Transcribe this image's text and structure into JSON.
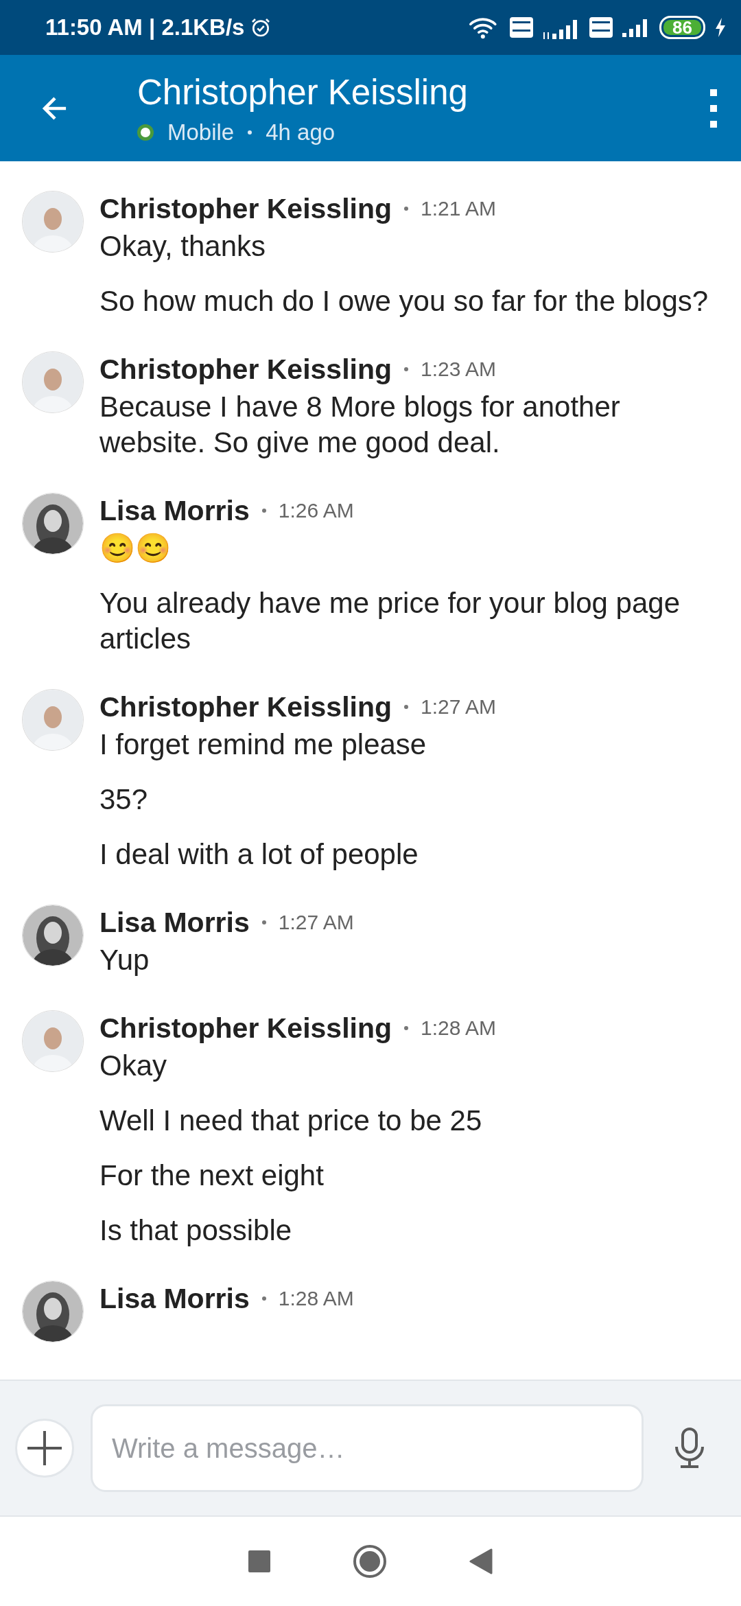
{
  "status_bar": {
    "text": "11:50 AM | 2.1KB/s",
    "battery": "86"
  },
  "header": {
    "title": "Christopher Keissling",
    "presence": "Mobile",
    "last_seen": "4h ago",
    "online": true
  },
  "messages": [
    {
      "sender": "Christopher Keissling",
      "kind": "light",
      "time": "1:21 AM",
      "texts": [
        "Okay, thanks",
        "So how much do I owe you so far for the blogs?"
      ]
    },
    {
      "sender": "Christopher Keissling",
      "kind": "light",
      "time": "1:23 AM",
      "texts": [
        "Because I have 8 More blogs for another website. So give me good deal."
      ]
    },
    {
      "sender": "Lisa Morris",
      "kind": "dark",
      "time": "1:26 AM",
      "texts": [
        "😊😊",
        "You already have me price for your blog page articles"
      ]
    },
    {
      "sender": "Christopher Keissling",
      "kind": "light",
      "time": "1:27 AM",
      "texts": [
        "I forget remind me please",
        "35?",
        "I deal with a lot of people"
      ]
    },
    {
      "sender": "Lisa Morris",
      "kind": "dark",
      "time": "1:27 AM",
      "texts": [
        "Yup"
      ]
    },
    {
      "sender": "Christopher Keissling",
      "kind": "light",
      "time": "1:28 AM",
      "texts": [
        "Okay",
        "Well I need that price to be 25",
        "For the next eight",
        "Is that possible"
      ]
    },
    {
      "sender": "Lisa Morris",
      "kind": "dark",
      "time": "1:28 AM"
    }
  ],
  "composer": {
    "placeholder": "Write a message…"
  }
}
